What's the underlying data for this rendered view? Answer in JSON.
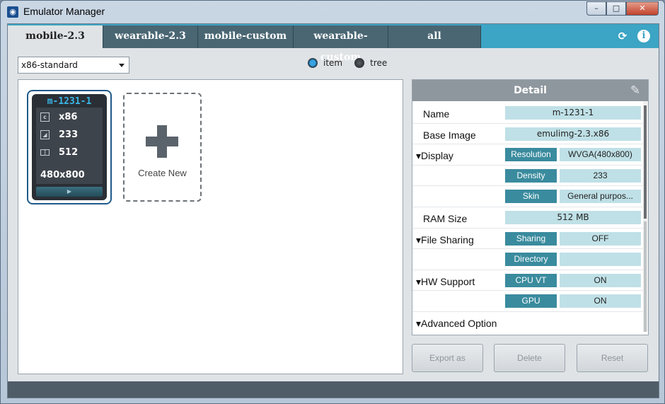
{
  "window": {
    "title": "Emulator Manager",
    "app_icon": "emulator-app-icon",
    "minimize": "–",
    "maximize": "□",
    "close": "✕"
  },
  "tabs": [
    {
      "label": "mobile-2.3"
    },
    {
      "label": "wearable-2.3"
    },
    {
      "label": "mobile-custom"
    },
    {
      "label": "wearable-custom"
    },
    {
      "label": "all"
    }
  ],
  "toolbar": {
    "refresh_icon": "refresh-icon",
    "info_icon": "info-icon"
  },
  "filter": {
    "selected": "x86-standard"
  },
  "view_mode": {
    "item_label": "item",
    "tree_label": "tree",
    "selected": "item"
  },
  "devices": [
    {
      "name": "m-1231-1",
      "cpu": "x86",
      "density": "233",
      "ram": "512",
      "resolution": "480x800"
    }
  ],
  "create_new": {
    "label": "Create New"
  },
  "detail": {
    "title": "Detail",
    "rows": {
      "name": {
        "label": "Name",
        "value": "m-1231-1"
      },
      "base_image": {
        "label": "Base Image",
        "value": "emulimg-2.3.x86"
      },
      "display": {
        "label": "Display",
        "resolution_key": "Resolution",
        "resolution_value": "WVGA(480x800)",
        "density_key": "Density",
        "density_value": "233",
        "skin_key": "Skin",
        "skin_value": "General purpos..."
      },
      "ram": {
        "label": "RAM Size",
        "value": "512 MB"
      },
      "file_sharing": {
        "label": "File Sharing",
        "sharing_key": "Sharing",
        "sharing_value": "OFF",
        "directory_key": "Directory",
        "directory_value": ""
      },
      "hw_support": {
        "label": "HW Support",
        "cpu_vt_key": "CPU VT",
        "cpu_vt_value": "ON",
        "gpu_key": "GPU",
        "gpu_value": "ON"
      },
      "advanced": {
        "label": "Advanced Option"
      }
    }
  },
  "actions": {
    "export": "Export as",
    "delete": "Delete",
    "reset": "Reset"
  },
  "colors": {
    "accent": "#3ca4c4",
    "tab_dark": "#4a6673",
    "value_bg": "#bfe0e6",
    "key_bg": "#3a8b9e"
  }
}
